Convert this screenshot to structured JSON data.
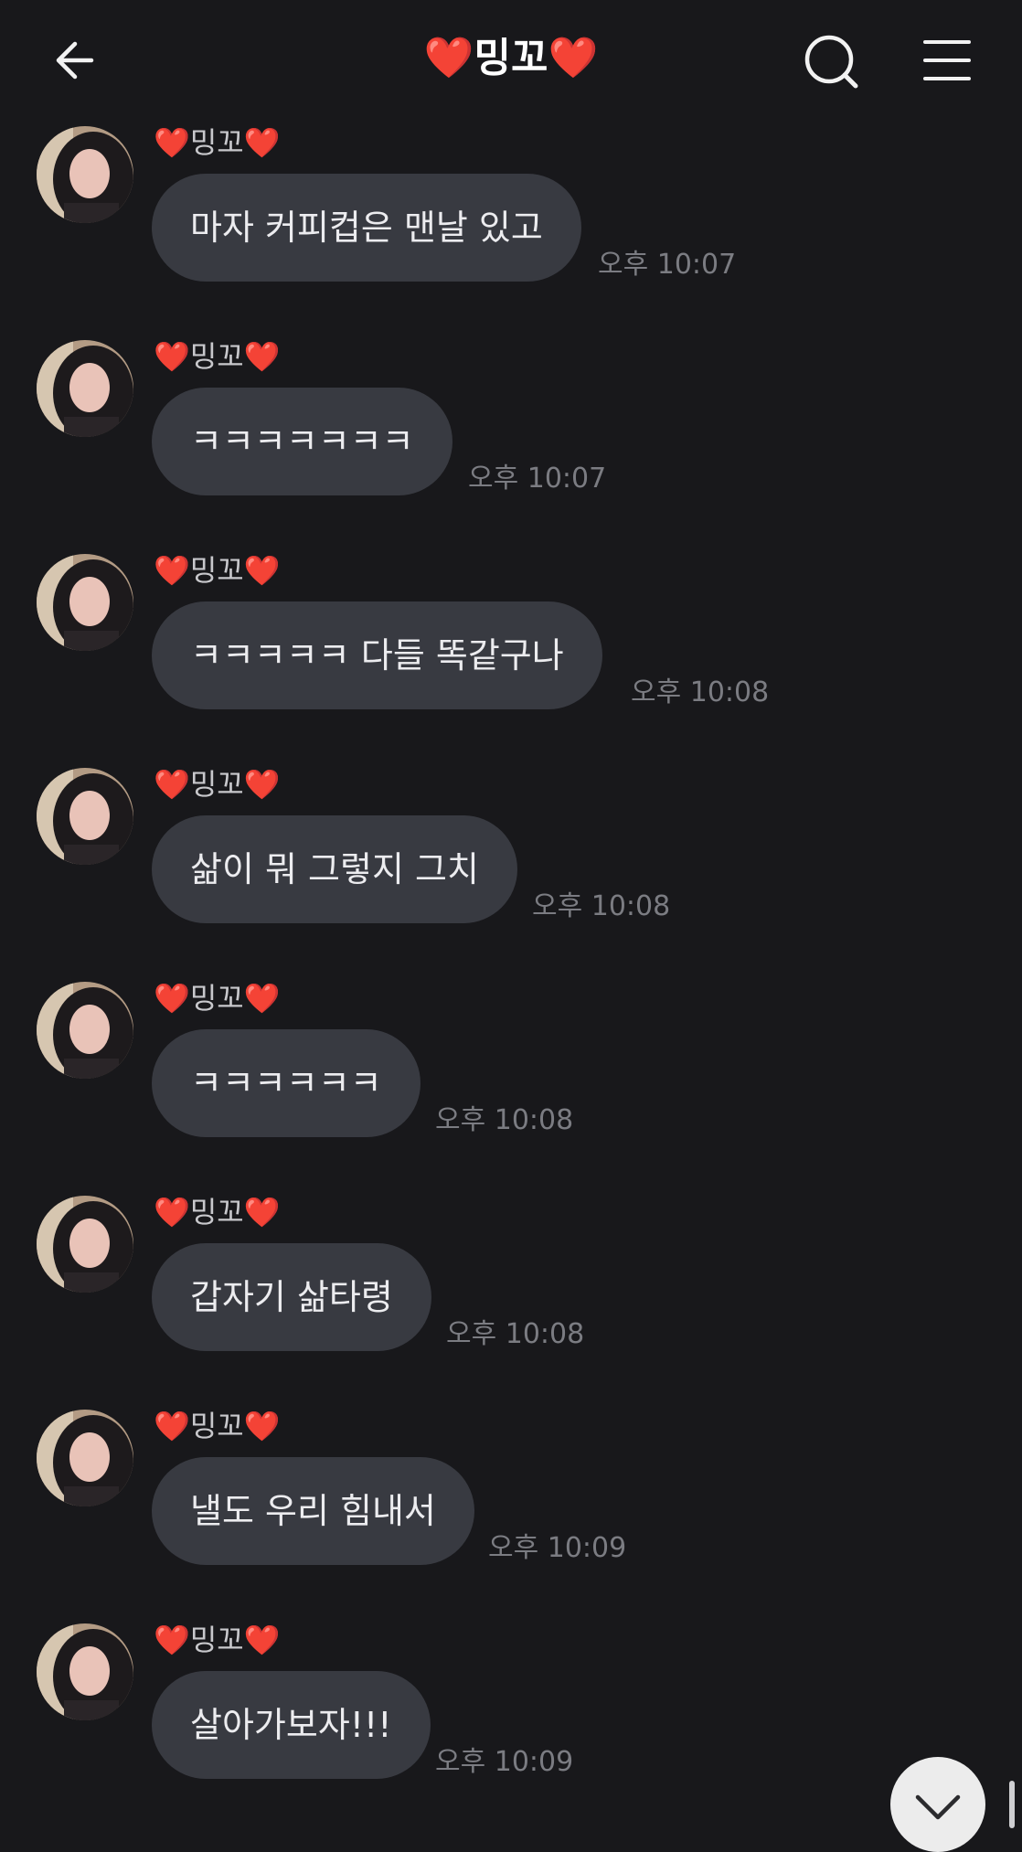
{
  "header": {
    "title": "❤️밍꼬❤️",
    "back_icon": "arrow-left-icon",
    "search_icon": "search-icon",
    "menu_icon": "hamburger-menu-icon"
  },
  "messages": [
    {
      "sender": "❤️밍꼬❤️",
      "text": "마자 커피컵은 맨날 있고",
      "time": "오후 10:07"
    },
    {
      "sender": "❤️밍꼬❤️",
      "text": "ㅋㅋㅋㅋㅋㅋㅋ",
      "time": "오후 10:07"
    },
    {
      "sender": "❤️밍꼬❤️",
      "text": "ㅋㅋㅋㅋㅋ  다들 똑같구나",
      "time": "오후 10:08"
    },
    {
      "sender": "❤️밍꼬❤️",
      "text": "삶이 뭐 그렇지 그치",
      "time": "오후 10:08"
    },
    {
      "sender": "❤️밍꼬❤️",
      "text": "ㅋㅋㅋㅋㅋㅋ",
      "time": "오후 10:08"
    },
    {
      "sender": "❤️밍꼬❤️",
      "text": "갑자기 삶타령",
      "time": "오후 10:08"
    },
    {
      "sender": "❤️밍꼬❤️",
      "text": "낼도 우리 힘내서",
      "time": "오후 10:09"
    },
    {
      "sender": "❤️밍꼬❤️",
      "text": "살아가보자!!!",
      "time": "오후 10:09"
    }
  ],
  "scroll_down_icon": "chevron-down-icon",
  "colors": {
    "background": "#18181b",
    "bubble": "#383a41",
    "bubble_text": "#ececef",
    "time_text": "#7b7c82",
    "heart": "#e8302c"
  }
}
